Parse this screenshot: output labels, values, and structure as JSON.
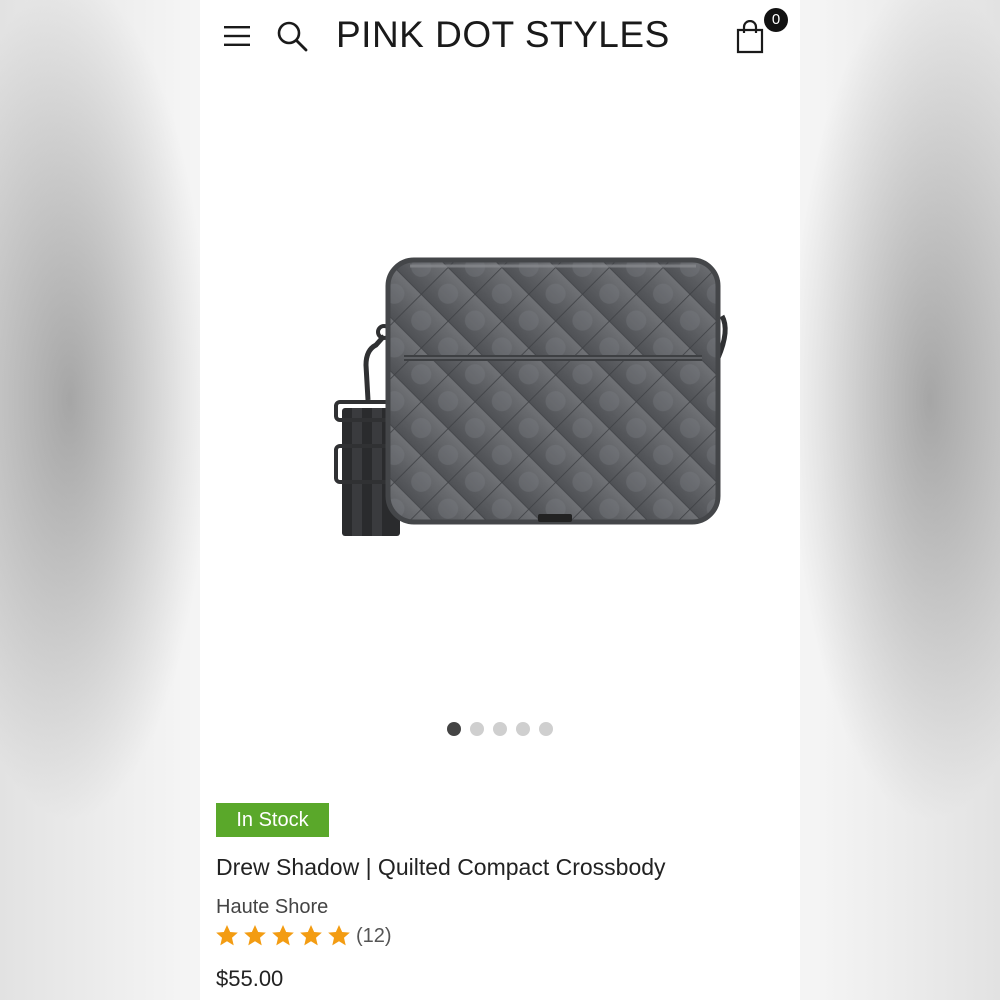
{
  "header": {
    "logo_text": "PINK DOT STYLES",
    "menu_icon": "hamburger-menu-icon",
    "search_icon": "search-icon",
    "cart_icon": "shopping-bag-icon",
    "cart_count": "0"
  },
  "gallery": {
    "image_subject": "gray quilted crossbody bag with black striped strap",
    "total_images": 5,
    "active_index": 0
  },
  "product": {
    "stock_status": "In Stock",
    "title": "Drew Shadow | Quilted Compact Crossbody",
    "brand": "Haute Shore",
    "rating_stars": 5,
    "review_count": "(12)",
    "price": "$55.00"
  },
  "colors": {
    "stock_badge": "#5aa82a",
    "star": "#f39c12",
    "dot_active": "#444444",
    "dot_inactive": "#cfcfcf",
    "cart_badge": "#111111"
  }
}
